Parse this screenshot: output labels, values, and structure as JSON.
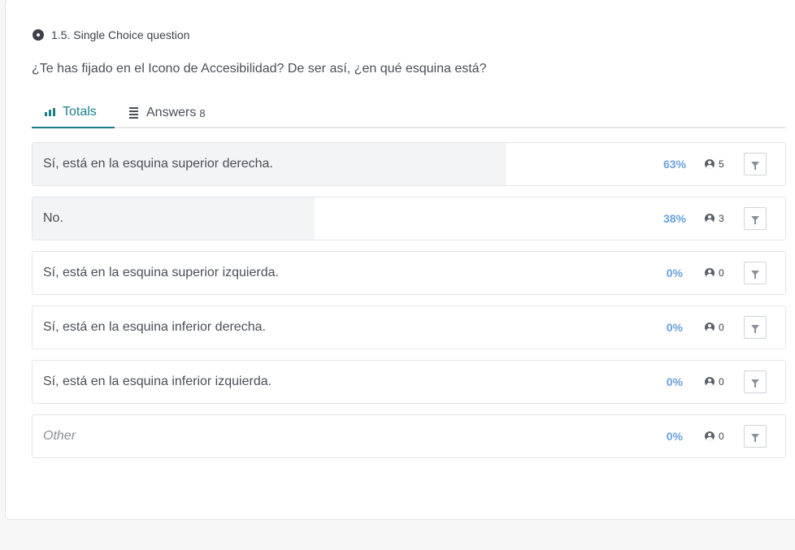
{
  "question": {
    "type_label": "1.5. Single Choice question",
    "text": "¿Te has fijado en el Icono de Accesibilidad? De ser así, ¿en qué esquina está?"
  },
  "tabs": {
    "totals_label": "Totals",
    "answers_label": "Answers",
    "answers_count": "8"
  },
  "options": [
    {
      "label": "Sí, está en la esquina superior derecha.",
      "percent_text": "63%",
      "percent": 0.63,
      "votes": "5"
    },
    {
      "label": "No.",
      "percent_text": "38%",
      "percent": 0.375,
      "votes": "3"
    },
    {
      "label": "Sí, está en la esquina superior izquierda.",
      "percent_text": "0%",
      "percent": 0,
      "votes": "0"
    },
    {
      "label": "Sí, está en la esquina inferior derecha.",
      "percent_text": "0%",
      "percent": 0,
      "votes": "0"
    },
    {
      "label": "Sí, está en la esquina inferior izquierda.",
      "percent_text": "0%",
      "percent": 0,
      "votes": "0"
    },
    {
      "label": "Other",
      "percent_text": "0%",
      "percent": 0,
      "votes": "0"
    }
  ],
  "colors": {
    "accent": "#1b7f8a",
    "percent_text": "#6aa0e0",
    "bar_fill": "#f3f4f5"
  }
}
